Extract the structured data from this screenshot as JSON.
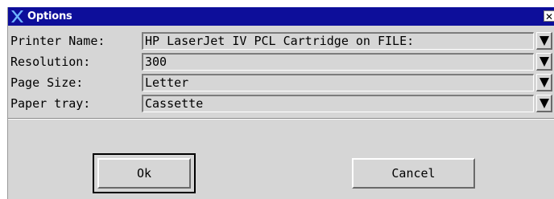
{
  "dialog": {
    "title": "Options",
    "close_glyph": "✕",
    "icons": {
      "app": "x-logo-icon",
      "close": "close-icon",
      "dropdown": "triangle-down-icon"
    }
  },
  "fields": [
    {
      "label": "Printer Name:",
      "value": "HP LaserJet IV PCL Cartridge on FILE:"
    },
    {
      "label": "Resolution:",
      "value": "300"
    },
    {
      "label": "Page Size:",
      "value": "Letter"
    },
    {
      "label": "Paper tray:",
      "value": "Cassette"
    }
  ],
  "buttons": {
    "ok_label": "Ok",
    "cancel_label": "Cancel"
  },
  "colors": {
    "titlebar": "#0d0e9a",
    "dialog_bg": "#d6d6d6"
  }
}
